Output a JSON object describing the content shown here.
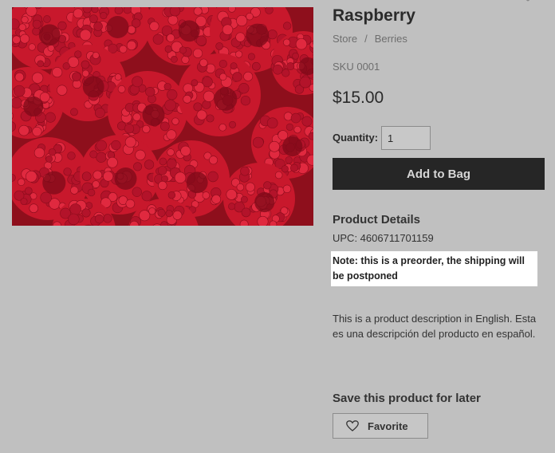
{
  "product": {
    "title": "Raspberry",
    "breadcrumb": [
      "Store",
      "Berries"
    ],
    "breadcrumb_separator": "/",
    "sku": "SKU 0001",
    "price": "$15.00",
    "image_icon": "raspberry-photo"
  },
  "purchase": {
    "quantity_label": "Quantity:",
    "quantity_value": "1",
    "add_to_bag_label": "Add to Bag"
  },
  "details": {
    "heading": "Product Details",
    "upc": "UPC: 4606711701159",
    "note": "Note: this is a preorder, the shipping will be postponed",
    "description": "This is a product description in English. Esta es una descripción del producto en español."
  },
  "save": {
    "heading": "Save this product for later",
    "favorite_label": "Favorite",
    "favorite_icon": "heart-icon"
  },
  "colors": {
    "overlay_background": "#c0c0c0",
    "button_dark": "#262626",
    "note_highlight": "#ffffff",
    "raspberry_red": "#c8182c"
  }
}
